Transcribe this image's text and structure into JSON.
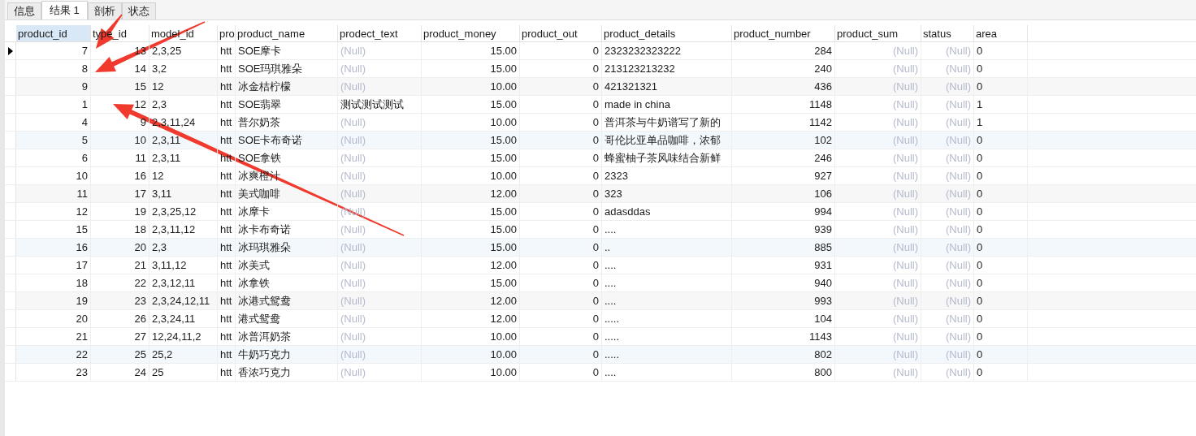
{
  "tabs": [
    {
      "label": "信息",
      "selected": false
    },
    {
      "label": "结果 1",
      "selected": true
    },
    {
      "label": "剖析",
      "selected": false
    },
    {
      "label": "状态",
      "selected": false
    }
  ],
  "table": {
    "columns": [
      {
        "label": "product_id",
        "kind": "number",
        "selected": true
      },
      {
        "label": "type_id",
        "kind": "number",
        "selected": false
      },
      {
        "label": "model_id",
        "kind": "text",
        "selected": false
      },
      {
        "label": "pro",
        "kind": "text",
        "selected": false
      },
      {
        "label": "product_name",
        "kind": "text",
        "selected": false
      },
      {
        "label": "prodect_text",
        "kind": "text",
        "selected": false
      },
      {
        "label": "product_money",
        "kind": "number",
        "selected": false
      },
      {
        "label": "product_out",
        "kind": "number",
        "selected": false
      },
      {
        "label": "product_details",
        "kind": "text",
        "selected": false
      },
      {
        "label": "product_number",
        "kind": "number",
        "selected": false
      },
      {
        "label": "product_sum",
        "kind": "number",
        "selected": false
      },
      {
        "label": "status",
        "kind": "number",
        "selected": false
      },
      {
        "label": "area",
        "kind": "text",
        "selected": false
      }
    ],
    "rows": [
      {
        "selected": true,
        "cells": [
          "7",
          "13",
          "2,3,25",
          "htt",
          "SOE摩卡",
          {
            "text": "(Null)",
            "null": true
          },
          "15.00",
          "0",
          "2323232323222",
          "284",
          {
            "text": "(Null)",
            "null": true
          },
          {
            "text": "(Null)",
            "null": true
          },
          "0"
        ]
      },
      {
        "selected": false,
        "cells": [
          "8",
          "14",
          "3,2",
          "htt",
          "SOE玛琪雅朵",
          {
            "text": "(Null)",
            "null": true
          },
          "15.00",
          "0",
          "213123213232",
          "240",
          {
            "text": "(Null)",
            "null": true
          },
          {
            "text": "(Null)",
            "null": true
          },
          "0"
        ]
      },
      {
        "selected": false,
        "cells": [
          "9",
          "15",
          "12",
          "htt",
          "冰金桔柠檬",
          {
            "text": "(Null)",
            "null": true
          },
          "10.00",
          "0",
          "421321321",
          "436",
          {
            "text": "(Null)",
            "null": true
          },
          {
            "text": "(Null)",
            "null": true
          },
          "0"
        ]
      },
      {
        "selected": false,
        "cells": [
          "1",
          "12",
          "2,3",
          "htt",
          "SOE翡翠",
          "测试测试测试",
          "15.00",
          "0",
          "made in china",
          "1148",
          {
            "text": "(Null)",
            "null": true
          },
          {
            "text": "(Null)",
            "null": true
          },
          "1"
        ]
      },
      {
        "selected": false,
        "cells": [
          "4",
          "9",
          "2,3,11,24",
          "htt",
          "普尔奶茶",
          {
            "text": "(Null)",
            "null": true
          },
          "10.00",
          "0",
          "普洱茶与牛奶谱写了新的",
          "1142",
          {
            "text": "(Null)",
            "null": true
          },
          {
            "text": "(Null)",
            "null": true
          },
          "1"
        ]
      },
      {
        "selected": false,
        "cells": [
          "5",
          "10",
          "2,3,11",
          "htt",
          "SOE卡布奇诺",
          {
            "text": "(Null)",
            "null": true
          },
          "15.00",
          "0",
          "哥伦比亚单品咖啡，浓郁",
          "102",
          {
            "text": "(Null)",
            "null": true
          },
          {
            "text": "(Null)",
            "null": true
          },
          "0"
        ]
      },
      {
        "selected": false,
        "cells": [
          "6",
          "11",
          "2,3,11",
          "htt",
          "SOE拿铁",
          {
            "text": "(Null)",
            "null": true
          },
          "15.00",
          "0",
          "蜂蜜柚子茶风味结合新鲜",
          "246",
          {
            "text": "(Null)",
            "null": true
          },
          {
            "text": "(Null)",
            "null": true
          },
          "0"
        ]
      },
      {
        "selected": false,
        "cells": [
          "10",
          "16",
          "12",
          "htt",
          "冰爽橙汁",
          {
            "text": "(Null)",
            "null": true
          },
          "10.00",
          "0",
          "2323",
          "927",
          {
            "text": "(Null)",
            "null": true
          },
          {
            "text": "(Null)",
            "null": true
          },
          "0"
        ]
      },
      {
        "selected": false,
        "cells": [
          "11",
          "17",
          "3,11",
          "htt",
          "美式咖啡",
          {
            "text": "(Null)",
            "null": true
          },
          "12.00",
          "0",
          "323",
          "106",
          {
            "text": "(Null)",
            "null": true
          },
          {
            "text": "(Null)",
            "null": true
          },
          "0"
        ]
      },
      {
        "selected": false,
        "cells": [
          "12",
          "19",
          "2,3,25,12",
          "htt",
          "冰摩卡",
          {
            "text": "(Null)",
            "null": true
          },
          "15.00",
          "0",
          "adasddas",
          "994",
          {
            "text": "(Null)",
            "null": true
          },
          {
            "text": "(Null)",
            "null": true
          },
          "0"
        ]
      },
      {
        "selected": false,
        "cells": [
          "15",
          "18",
          "2,3,11,12",
          "htt",
          "冰卡布奇诺",
          {
            "text": "(Null)",
            "null": true
          },
          "15.00",
          "0",
          "....",
          "939",
          {
            "text": "(Null)",
            "null": true
          },
          {
            "text": "(Null)",
            "null": true
          },
          "0"
        ]
      },
      {
        "selected": false,
        "cells": [
          "16",
          "20",
          "2,3",
          "htt",
          "冰玛琪雅朵",
          {
            "text": "(Null)",
            "null": true
          },
          "15.00",
          "0",
          "..",
          "885",
          {
            "text": "(Null)",
            "null": true
          },
          {
            "text": "(Null)",
            "null": true
          },
          "0"
        ]
      },
      {
        "selected": false,
        "cells": [
          "17",
          "21",
          "3,11,12",
          "htt",
          "冰美式",
          {
            "text": "(Null)",
            "null": true
          },
          "12.00",
          "0",
          "....",
          "931",
          {
            "text": "(Null)",
            "null": true
          },
          {
            "text": "(Null)",
            "null": true
          },
          "0"
        ]
      },
      {
        "selected": false,
        "cells": [
          "18",
          "22",
          "2,3,12,11",
          "htt",
          "冰拿铁",
          {
            "text": "(Null)",
            "null": true
          },
          "15.00",
          "0",
          "....",
          "940",
          {
            "text": "(Null)",
            "null": true
          },
          {
            "text": "(Null)",
            "null": true
          },
          "0"
        ]
      },
      {
        "selected": false,
        "cells": [
          "19",
          "23",
          "2,3,24,12,11",
          "htt",
          "冰港式鸳鸯",
          {
            "text": "(Null)",
            "null": true
          },
          "12.00",
          "0",
          "....",
          "993",
          {
            "text": "(Null)",
            "null": true
          },
          {
            "text": "(Null)",
            "null": true
          },
          "0"
        ]
      },
      {
        "selected": false,
        "cells": [
          "20",
          "26",
          "2,3,24,11",
          "htt",
          "港式鸳鸯",
          {
            "text": "(Null)",
            "null": true
          },
          "12.00",
          "0",
          ".....",
          "104",
          {
            "text": "(Null)",
            "null": true
          },
          {
            "text": "(Null)",
            "null": true
          },
          "0"
        ]
      },
      {
        "selected": false,
        "cells": [
          "21",
          "27",
          "12,24,11,2",
          "htt",
          "冰普洱奶茶",
          {
            "text": "(Null)",
            "null": true
          },
          "10.00",
          "0",
          ".....",
          "1143",
          {
            "text": "(Null)",
            "null": true
          },
          {
            "text": "(Null)",
            "null": true
          },
          "0"
        ]
      },
      {
        "selected": false,
        "cells": [
          "22",
          "25",
          "25,2",
          "htt",
          "牛奶巧克力",
          {
            "text": "(Null)",
            "null": true
          },
          "10.00",
          "0",
          ".....",
          "802",
          {
            "text": "(Null)",
            "null": true
          },
          {
            "text": "(Null)",
            "null": true
          },
          "0"
        ]
      },
      {
        "selected": false,
        "cells": [
          "23",
          "24",
          "25",
          "htt",
          "香浓巧克力",
          {
            "text": "(Null)",
            "null": true
          },
          "10.00",
          "0",
          "....",
          "800",
          {
            "text": "(Null)",
            "null": true
          },
          {
            "text": "(Null)",
            "null": true
          },
          "0"
        ]
      }
    ]
  }
}
